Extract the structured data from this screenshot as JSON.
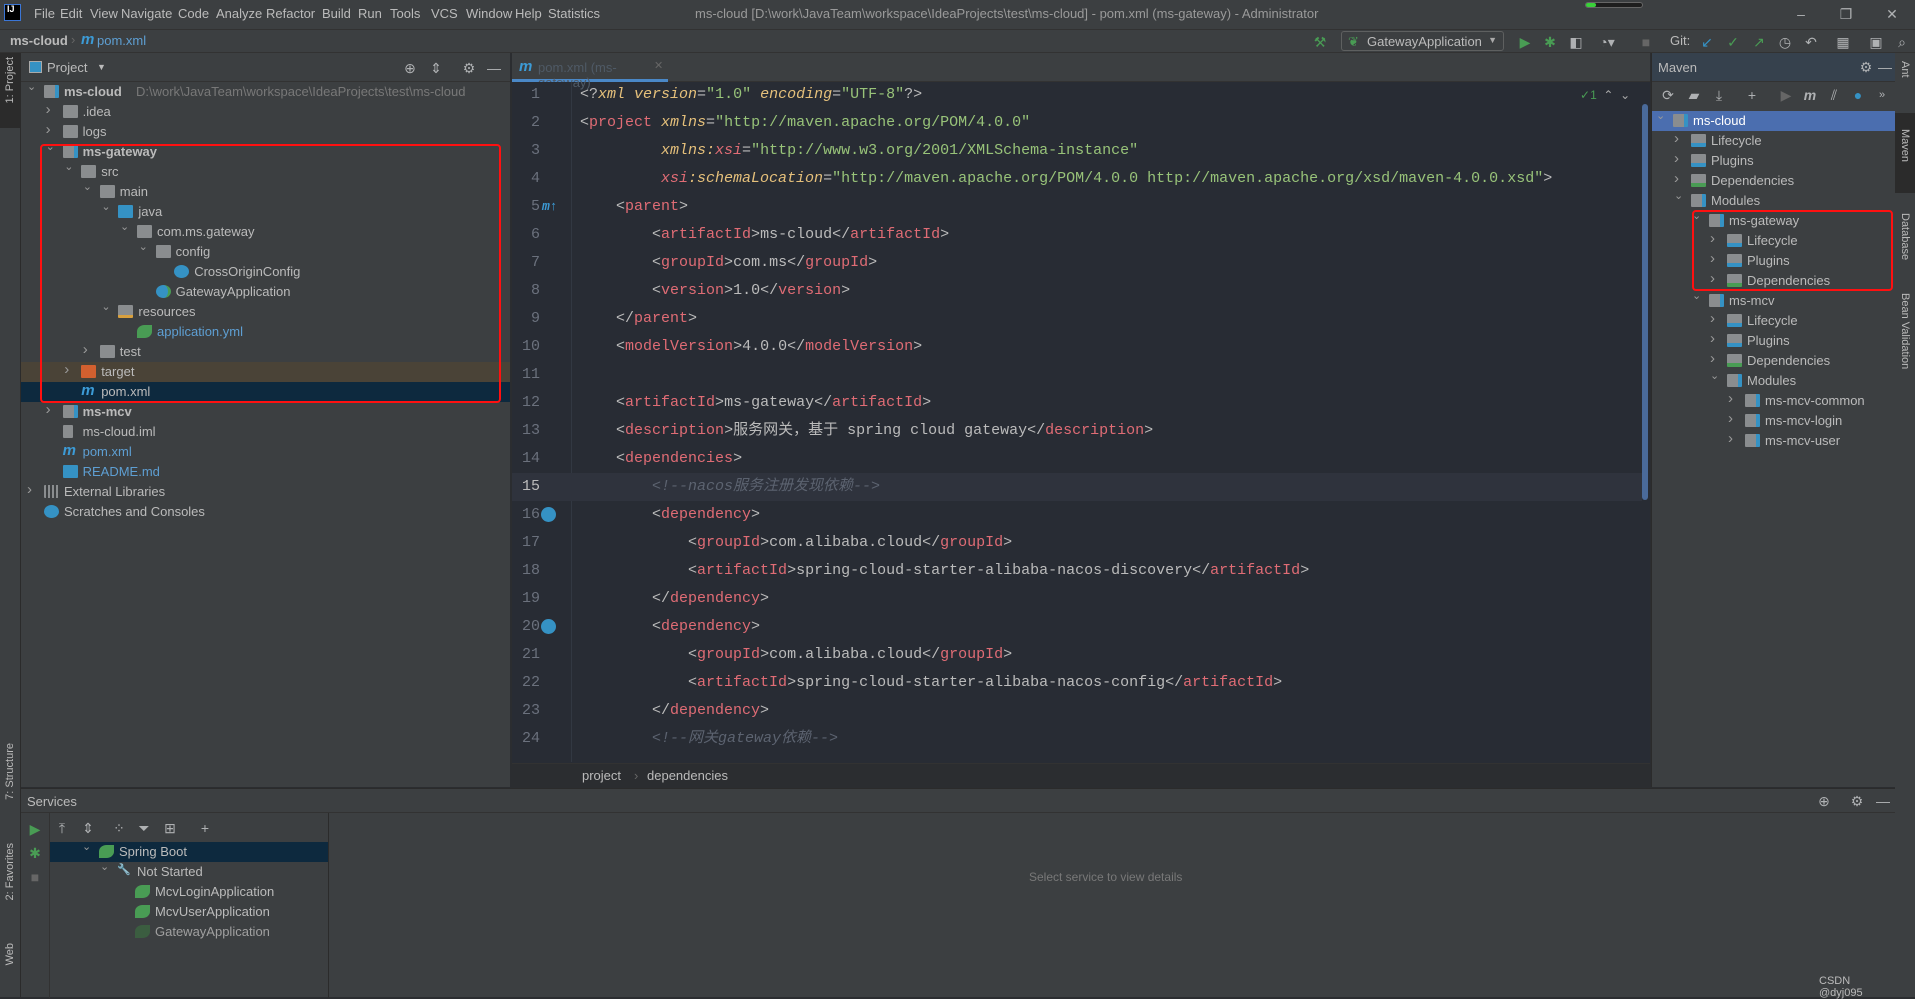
{
  "window": {
    "title": "ms-cloud [D:\\work\\JavaTeam\\workspace\\IdeaProjects\\test\\ms-cloud] - pom.xml (ms-gateway) - Administrator",
    "app_icon": "intellij-icon",
    "controls": [
      "minimize",
      "restore",
      "close"
    ]
  },
  "menu": [
    "File",
    "Edit",
    "View",
    "Navigate",
    "Code",
    "Analyze",
    "Refactor",
    "Build",
    "Run",
    "Tools",
    "VCS",
    "Window",
    "Help",
    "Statistics"
  ],
  "navbar": {
    "project": "ms-cloud",
    "file": "pom.xml",
    "run_config": "GatewayApplication",
    "git_label": "Git:"
  },
  "left_stripe": {
    "top": "1: Project",
    "mid": "7: Structure",
    "fav": "2: Favorites",
    "web": "Web"
  },
  "right_stripe": [
    "Ant",
    "Maven",
    "Database",
    "Bean Validation"
  ],
  "project": {
    "title": "Project",
    "tree": [
      {
        "label": "ms-cloud",
        "path": "D:\\work\\JavaTeam\\workspace\\IdeaProjects\\test\\ms-cloud",
        "depth": 0,
        "arrow": "down",
        "icon": "module-folder",
        "bold": true
      },
      {
        "label": ".idea",
        "depth": 1,
        "arrow": "right",
        "icon": "folder"
      },
      {
        "label": "logs",
        "depth": 1,
        "arrow": "right",
        "icon": "folder"
      },
      {
        "label": "ms-gateway",
        "depth": 1,
        "arrow": "down",
        "icon": "module-folder",
        "bold": true
      },
      {
        "label": "src",
        "depth": 2,
        "arrow": "down",
        "icon": "folder"
      },
      {
        "label": "main",
        "depth": 3,
        "arrow": "down",
        "icon": "folder"
      },
      {
        "label": "java",
        "depth": 4,
        "arrow": "down",
        "icon": "source-folder"
      },
      {
        "label": "com.ms.gateway",
        "depth": 5,
        "arrow": "down",
        "icon": "package"
      },
      {
        "label": "config",
        "depth": 6,
        "arrow": "down",
        "icon": "package"
      },
      {
        "label": "CrossOriginConfig",
        "depth": 7,
        "arrow": "",
        "icon": "class"
      },
      {
        "label": "GatewayApplication",
        "depth": 6,
        "arrow": "",
        "icon": "spring-class"
      },
      {
        "label": "resources",
        "depth": 4,
        "arrow": "down",
        "icon": "resources-folder"
      },
      {
        "label": "application.yml",
        "depth": 5,
        "arrow": "",
        "icon": "spring-yml",
        "color": "#5e9fd3"
      },
      {
        "label": "test",
        "depth": 3,
        "arrow": "right",
        "icon": "folder"
      },
      {
        "label": "target",
        "depth": 2,
        "arrow": "right",
        "icon": "excluded-folder",
        "state": "excluded"
      },
      {
        "label": "pom.xml",
        "depth": 2,
        "arrow": "",
        "icon": "maven",
        "state": "selected"
      },
      {
        "label": "ms-mcv",
        "depth": 1,
        "arrow": "right",
        "icon": "module-folder",
        "bold": true
      },
      {
        "label": "ms-cloud.iml",
        "depth": 1,
        "arrow": "",
        "icon": "iml"
      },
      {
        "label": "pom.xml",
        "depth": 1,
        "arrow": "",
        "icon": "maven",
        "color": "#5e9fd3"
      },
      {
        "label": "README.md",
        "depth": 1,
        "arrow": "",
        "icon": "markdown",
        "color": "#5e9fd3"
      },
      {
        "label": "External Libraries",
        "depth": 0,
        "arrow": "right",
        "icon": "libraries"
      },
      {
        "label": "Scratches and Consoles",
        "depth": 0,
        "arrow": "",
        "icon": "scratches"
      }
    ]
  },
  "editor": {
    "tab": "pom.xml (ms-gateway)",
    "inspection": "1",
    "current_line": 15,
    "breadcrumb": [
      "project",
      "dependencies"
    ],
    "lines": [
      [
        [
          "b",
          "<?"
        ],
        [
          "a",
          "xml "
        ],
        [
          "a",
          "version"
        ],
        [
          "b",
          "="
        ],
        [
          "v",
          "\"1.0\" "
        ],
        [
          "a",
          "encoding"
        ],
        [
          "b",
          "="
        ],
        [
          "v",
          "\"UTF-8\""
        ],
        [
          "b",
          "?>"
        ]
      ],
      [
        [
          "b",
          "<"
        ],
        [
          "t",
          "project "
        ],
        [
          "a",
          "xmlns"
        ],
        [
          "b",
          "="
        ],
        [
          "v",
          "\"http://maven.apache.org/POM/4.0.0\""
        ]
      ],
      [
        [
          "e",
          "         "
        ],
        [
          "a",
          "xmlns:"
        ],
        [
          "p",
          "xsi"
        ],
        [
          "b",
          "="
        ],
        [
          "v",
          "\"http://www.w3.org/2001/XMLSchema-instance\""
        ]
      ],
      [
        [
          "e",
          "         "
        ],
        [
          "p",
          "xsi"
        ],
        [
          "a",
          ":schemaLocation"
        ],
        [
          "b",
          "="
        ],
        [
          "v",
          "\"http://maven.apache.org/POM/4.0.0 http://maven.apache.org/xsd/maven-4.0.0.xsd\""
        ],
        [
          "b",
          ">"
        ]
      ],
      [
        [
          "e",
          "    "
        ],
        [
          "b",
          "<"
        ],
        [
          "t",
          "parent"
        ],
        [
          "b",
          ">"
        ]
      ],
      [
        [
          "e",
          "        "
        ],
        [
          "b",
          "<"
        ],
        [
          "t",
          "artifactId"
        ],
        [
          "b",
          ">"
        ],
        [
          "x",
          "ms-cloud"
        ],
        [
          "b",
          "</"
        ],
        [
          "t",
          "artifactId"
        ],
        [
          "b",
          ">"
        ]
      ],
      [
        [
          "e",
          "        "
        ],
        [
          "b",
          "<"
        ],
        [
          "t",
          "groupId"
        ],
        [
          "b",
          ">"
        ],
        [
          "x",
          "com.ms"
        ],
        [
          "b",
          "</"
        ],
        [
          "t",
          "groupId"
        ],
        [
          "b",
          ">"
        ]
      ],
      [
        [
          "e",
          "        "
        ],
        [
          "b",
          "<"
        ],
        [
          "t",
          "version"
        ],
        [
          "b",
          ">"
        ],
        [
          "x",
          "1.0"
        ],
        [
          "b",
          "</"
        ],
        [
          "t",
          "version"
        ],
        [
          "b",
          ">"
        ]
      ],
      [
        [
          "e",
          "    "
        ],
        [
          "b",
          "</"
        ],
        [
          "t",
          "parent"
        ],
        [
          "b",
          ">"
        ]
      ],
      [
        [
          "e",
          "    "
        ],
        [
          "b",
          "<"
        ],
        [
          "t",
          "modelVersion"
        ],
        [
          "b",
          ">"
        ],
        [
          "x",
          "4.0.0"
        ],
        [
          "b",
          "</"
        ],
        [
          "t",
          "modelVersion"
        ],
        [
          "b",
          ">"
        ]
      ],
      [],
      [
        [
          "e",
          "    "
        ],
        [
          "b",
          "<"
        ],
        [
          "t",
          "artifactId"
        ],
        [
          "b",
          ">"
        ],
        [
          "x",
          "ms-gateway"
        ],
        [
          "b",
          "</"
        ],
        [
          "t",
          "artifactId"
        ],
        [
          "b",
          ">"
        ]
      ],
      [
        [
          "e",
          "    "
        ],
        [
          "b",
          "<"
        ],
        [
          "t",
          "description"
        ],
        [
          "b",
          ">"
        ],
        [
          "x",
          "服务网关，基于 spring cloud gateway"
        ],
        [
          "b",
          "</"
        ],
        [
          "t",
          "description"
        ],
        [
          "b",
          ">"
        ]
      ],
      [
        [
          "e",
          "    "
        ],
        [
          "b",
          "<"
        ],
        [
          "t",
          "dependencies"
        ],
        [
          "b",
          ">"
        ]
      ],
      [
        [
          "e",
          "        "
        ],
        [
          "c",
          "<!--nacos服务注册发现依赖-->"
        ]
      ],
      [
        [
          "e",
          "        "
        ],
        [
          "b",
          "<"
        ],
        [
          "t",
          "dependency"
        ],
        [
          "b",
          ">"
        ]
      ],
      [
        [
          "e",
          "            "
        ],
        [
          "b",
          "<"
        ],
        [
          "t",
          "groupId"
        ],
        [
          "b",
          ">"
        ],
        [
          "x",
          "com.alibaba.cloud"
        ],
        [
          "b",
          "</"
        ],
        [
          "t",
          "groupId"
        ],
        [
          "b",
          ">"
        ]
      ],
      [
        [
          "e",
          "            "
        ],
        [
          "b",
          "<"
        ],
        [
          "t",
          "artifactId"
        ],
        [
          "b",
          ">"
        ],
        [
          "x",
          "spring-cloud-starter-alibaba-nacos-discovery"
        ],
        [
          "b",
          "</"
        ],
        [
          "t",
          "artifactId"
        ],
        [
          "b",
          ">"
        ]
      ],
      [
        [
          "e",
          "        "
        ],
        [
          "b",
          "</"
        ],
        [
          "t",
          "dependency"
        ],
        [
          "b",
          ">"
        ]
      ],
      [
        [
          "e",
          "        "
        ],
        [
          "b",
          "<"
        ],
        [
          "t",
          "dependency"
        ],
        [
          "b",
          ">"
        ]
      ],
      [
        [
          "e",
          "            "
        ],
        [
          "b",
          "<"
        ],
        [
          "t",
          "groupId"
        ],
        [
          "b",
          ">"
        ],
        [
          "x",
          "com.alibaba.cloud"
        ],
        [
          "b",
          "</"
        ],
        [
          "t",
          "groupId"
        ],
        [
          "b",
          ">"
        ]
      ],
      [
        [
          "e",
          "            "
        ],
        [
          "b",
          "<"
        ],
        [
          "t",
          "artifactId"
        ],
        [
          "b",
          ">"
        ],
        [
          "x",
          "spring-cloud-starter-alibaba-nacos-config"
        ],
        [
          "b",
          "</"
        ],
        [
          "t",
          "artifactId"
        ],
        [
          "b",
          ">"
        ]
      ],
      [
        [
          "e",
          "        "
        ],
        [
          "b",
          "</"
        ],
        [
          "t",
          "dependency"
        ],
        [
          "b",
          ">"
        ]
      ],
      [
        [
          "e",
          "        "
        ],
        [
          "c",
          "<!--网关gateway依赖-->"
        ]
      ]
    ]
  },
  "maven": {
    "title": "Maven",
    "tree": [
      {
        "label": "ms-cloud",
        "depth": 0,
        "arrow": "down",
        "icon": "maven-module",
        "state": "selected"
      },
      {
        "label": "Lifecycle",
        "depth": 1,
        "arrow": "right",
        "icon": "lifecycle"
      },
      {
        "label": "Plugins",
        "depth": 1,
        "arrow": "right",
        "icon": "plugins"
      },
      {
        "label": "Dependencies",
        "depth": 1,
        "arrow": "right",
        "icon": "dependencies"
      },
      {
        "label": "Modules",
        "depth": 1,
        "arrow": "down",
        "icon": "modules"
      },
      {
        "label": "ms-gateway",
        "depth": 2,
        "arrow": "down",
        "icon": "maven-module"
      },
      {
        "label": "Lifecycle",
        "depth": 3,
        "arrow": "right",
        "icon": "lifecycle"
      },
      {
        "label": "Plugins",
        "depth": 3,
        "arrow": "right",
        "icon": "plugins"
      },
      {
        "label": "Dependencies",
        "depth": 3,
        "arrow": "right",
        "icon": "dependencies"
      },
      {
        "label": "ms-mcv",
        "depth": 2,
        "arrow": "down",
        "icon": "maven-module"
      },
      {
        "label": "Lifecycle",
        "depth": 3,
        "arrow": "right",
        "icon": "lifecycle"
      },
      {
        "label": "Plugins",
        "depth": 3,
        "arrow": "right",
        "icon": "plugins"
      },
      {
        "label": "Dependencies",
        "depth": 3,
        "arrow": "right",
        "icon": "dependencies"
      },
      {
        "label": "Modules",
        "depth": 3,
        "arrow": "down",
        "icon": "modules"
      },
      {
        "label": "ms-mcv-common",
        "depth": 4,
        "arrow": "right",
        "icon": "maven-module"
      },
      {
        "label": "ms-mcv-login",
        "depth": 4,
        "arrow": "right",
        "icon": "maven-module"
      },
      {
        "label": "ms-mcv-user",
        "depth": 4,
        "arrow": "right",
        "icon": "maven-module"
      }
    ]
  },
  "services": {
    "title": "Services",
    "empty_text": "Select service to view details",
    "tree": [
      {
        "label": "Spring Boot",
        "depth": 0,
        "arrow": "down",
        "icon": "spring-boot",
        "state": "selected"
      },
      {
        "label": "Not Started",
        "depth": 1,
        "arrow": "down",
        "icon": "wrench"
      },
      {
        "label": "McvLoginApplication",
        "depth": 2,
        "arrow": "",
        "icon": "spring-boot"
      },
      {
        "label": "McvUserApplication",
        "depth": 2,
        "arrow": "",
        "icon": "spring-boot"
      },
      {
        "label": "GatewayApplication",
        "depth": 2,
        "arrow": "",
        "icon": "spring-boot-dim"
      }
    ]
  },
  "watermark": "CSDN @dyj095",
  "colors": {
    "accent": "#4b6eaf",
    "selected": "#0d293e",
    "highlight_box": "#ff1010",
    "tag": "#e06c75",
    "attr": "#e5c07b",
    "value": "#98c379",
    "run": "#499c54"
  }
}
